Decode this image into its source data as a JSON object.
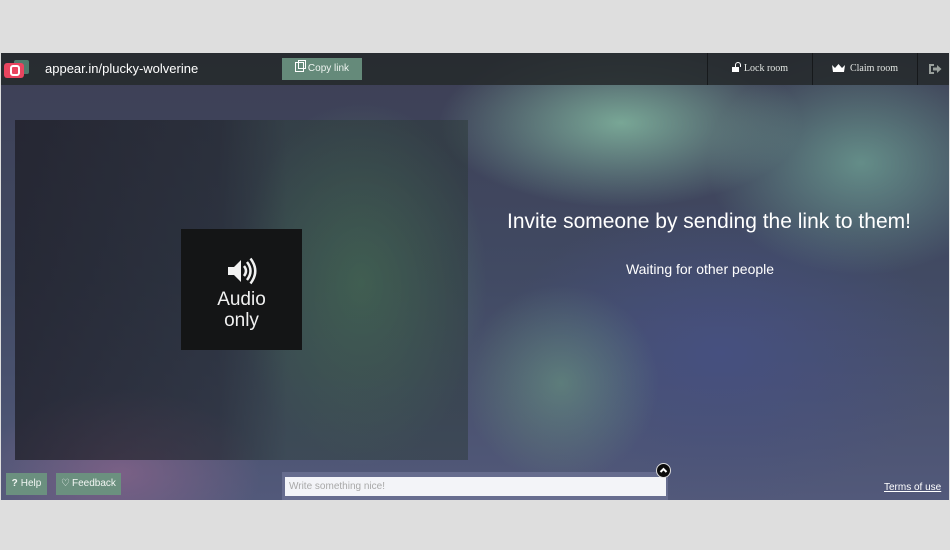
{
  "header": {
    "logo_icon": "appear-in-logo-icon",
    "room_name": "appear.in/plucky-wolverine",
    "copy_link_label": "Copy link",
    "copy_link_icon": "copy-icon",
    "lock_room_label": "Lock room",
    "lock_room_icon": "unlock-icon",
    "claim_room_label": "Claim room",
    "claim_room_icon": "crown-icon",
    "leave_icon": "leave-room-icon"
  },
  "video": {
    "audio_only_icon": "speaker-volume-icon",
    "audio_only_line1": "Audio",
    "audio_only_line2": "only"
  },
  "main": {
    "invite_title": "Invite someone by sending the link to them!",
    "waiting_text": "Waiting for other people"
  },
  "footer": {
    "help_label": "Help",
    "help_icon": "question-icon",
    "feedback_label": "Feedback",
    "feedback_icon": "heart-icon",
    "chat_placeholder": "Write something nice!",
    "chat_value": "",
    "chat_toggle_icon": "chevron-up-icon",
    "terms_label": "Terms of use"
  },
  "colors": {
    "button_green": "#6b907f",
    "logo_pink": "#e8455f",
    "topbar": "#262a2c"
  }
}
